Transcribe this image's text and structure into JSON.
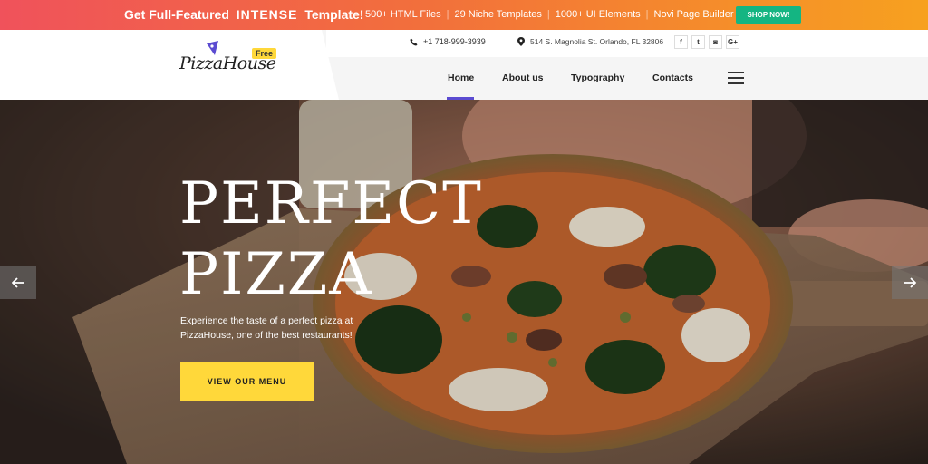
{
  "promo": {
    "headline_prefix": "Get Full-Featured",
    "headline_brand": "INTENSE",
    "headline_suffix": "Template!",
    "features": [
      "500+ HTML Files",
      "29 Niche Templates",
      "1000+ UI Elements",
      "Novi Page Builder"
    ],
    "shop_button": "SHOP NOW!"
  },
  "header": {
    "logo_text": "PizzaHouse",
    "logo_badge": "Free",
    "phone": "+1 718-999-3939",
    "address": "514 S. Magnolia St. Orlando, FL 32806",
    "social": [
      {
        "icon": "facebook-icon",
        "glyph": "f"
      },
      {
        "icon": "twitter-icon",
        "glyph": "t"
      },
      {
        "icon": "instagram-icon",
        "glyph": "◙"
      },
      {
        "icon": "google-plus-icon",
        "glyph": "G+"
      }
    ]
  },
  "nav": {
    "items": [
      "Home",
      "About us",
      "Typography",
      "Contacts"
    ],
    "active": "Home"
  },
  "hero": {
    "title_line1": "PERFECT",
    "title_line2": "PIZZA",
    "subtitle": "Experience the taste of a perfect pizza at PizzaHouse, one of the best restaurants!",
    "cta": "VIEW OUR MENU"
  },
  "colors": {
    "accent": "#5b4bd1",
    "cta": "#ffd83a",
    "shop_button": "#14b582"
  }
}
